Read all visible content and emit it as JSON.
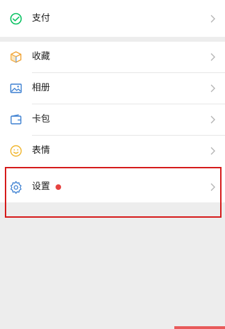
{
  "menu": {
    "pay": {
      "label": "支付",
      "icon": "wechat-pay-icon",
      "color": "#07c160"
    },
    "items": [
      {
        "label": "收藏",
        "icon": "favorites-cube-icon"
      },
      {
        "label": "相册",
        "icon": "album-picture-icon"
      },
      {
        "label": "卡包",
        "icon": "card-wallet-icon"
      },
      {
        "label": "表情",
        "icon": "sticker-smile-icon"
      },
      {
        "label": "设置",
        "icon": "settings-gear-icon",
        "badge": "red-dot"
      }
    ]
  },
  "colors": {
    "background": "#ededed",
    "highlight": "#d51a1a",
    "badge": "#e64340",
    "pay_green": "#07c160"
  }
}
